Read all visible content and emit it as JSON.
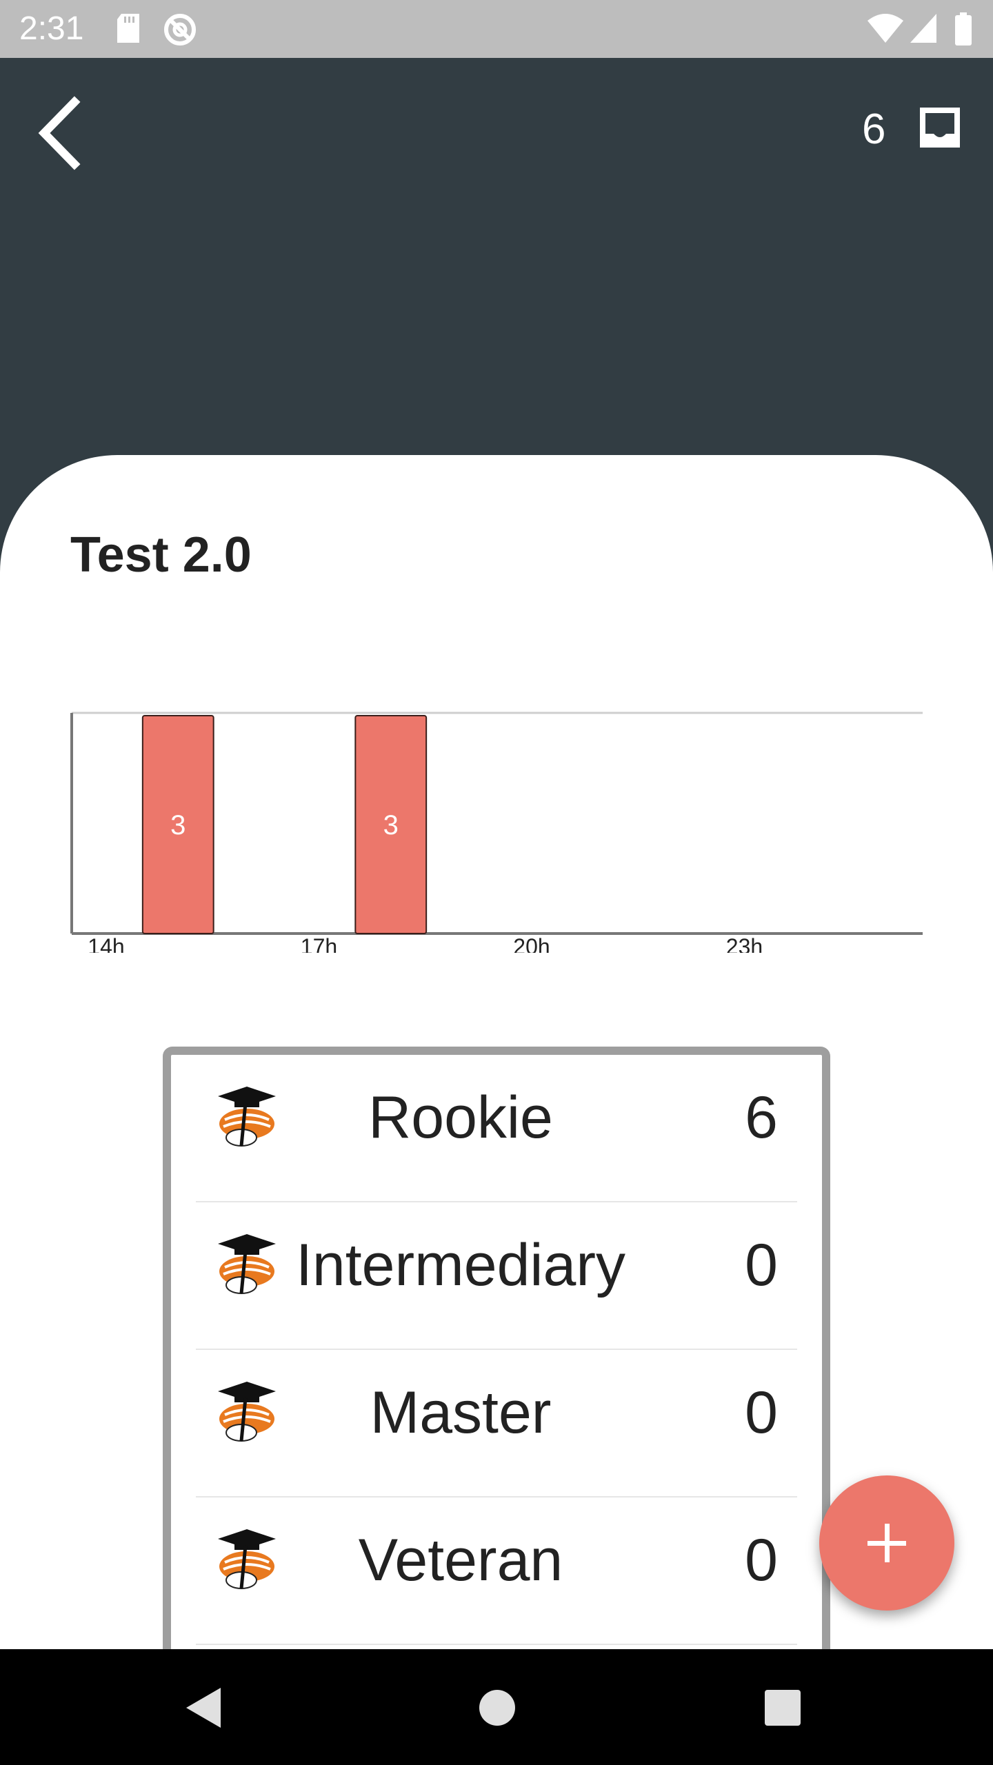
{
  "status_bar": {
    "time": "2:31",
    "icons": [
      "sd-card-icon",
      "sync-disabled-icon",
      "wifi-icon",
      "cell-signal-icon",
      "battery-icon"
    ]
  },
  "app_bar": {
    "background": "#323d43",
    "back_icon": "chevron-left-icon",
    "inbox_count": "6",
    "inbox_icon": "inbox-icon"
  },
  "title": "Test 2.0",
  "chart_data": {
    "type": "bar",
    "x_ticks": [
      "14h",
      "17h",
      "20h",
      "23h"
    ],
    "bars": [
      {
        "start_hour": 15,
        "end_hour": 16,
        "value": 3
      },
      {
        "start_hour": 18,
        "end_hour": 19,
        "value": 3
      }
    ],
    "data_labels": [
      "3",
      "3"
    ],
    "xlim": [
      14,
      26
    ],
    "ylim": [
      0,
      3
    ],
    "bar_color": "#ec776b",
    "grid": false
  },
  "ranks": [
    {
      "name": "Rookie",
      "count": "6",
      "icon": "sushi-graduate-icon"
    },
    {
      "name": "Intermediary",
      "count": "0",
      "icon": "sushi-graduate-icon"
    },
    {
      "name": "Master",
      "count": "0",
      "icon": "sushi-graduate-icon"
    },
    {
      "name": "Veteran",
      "count": "0",
      "icon": "sushi-graduate-icon"
    }
  ],
  "fab": {
    "icon": "plus-icon",
    "color": "#ec776b"
  },
  "nav_bar": {
    "icons": [
      "back-triangle-icon",
      "home-circle-icon",
      "recents-square-icon"
    ]
  }
}
